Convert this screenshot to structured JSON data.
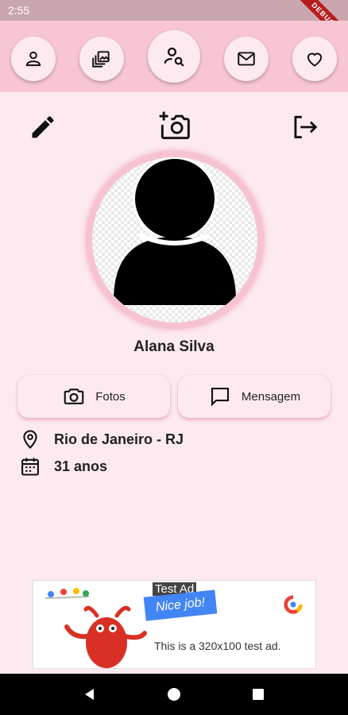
{
  "status_bar": {
    "time": "2:55"
  },
  "debug_banner": "DEBUG",
  "top_nav": [
    {
      "name": "profile-nav-button",
      "icon": "person-icon"
    },
    {
      "name": "gallery-nav-button",
      "icon": "photo-library-icon"
    },
    {
      "name": "search-people-nav-button",
      "icon": "person-search-icon"
    },
    {
      "name": "messages-nav-button",
      "icon": "mail-icon"
    },
    {
      "name": "favorites-nav-button",
      "icon": "heart-icon"
    }
  ],
  "actions": {
    "edit": "edit-pencil-icon",
    "add_photo": "add-camera-icon",
    "logout": "logout-icon"
  },
  "profile": {
    "name": "Alana Silva",
    "location": "Rio de Janeiro - RJ",
    "age": "31 anos"
  },
  "buttons": {
    "photos_label": "Fotos",
    "message_label": "Mensagem"
  },
  "ad": {
    "label": "Test Ad",
    "text": "This is a 320x100 test ad.",
    "banner_text": "Nice job!"
  },
  "colors": {
    "background": "#fdeaf0",
    "nav_bar": "#f7c6d2",
    "accent": "#f6c3d1"
  }
}
